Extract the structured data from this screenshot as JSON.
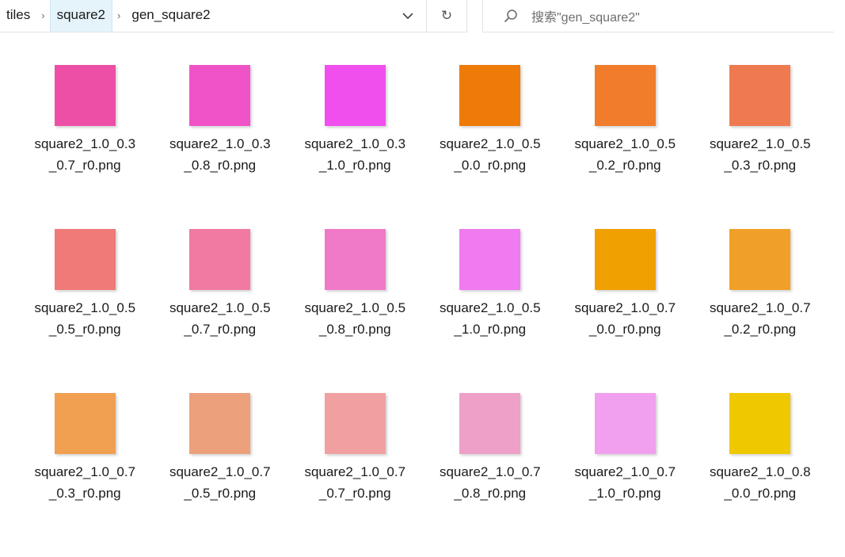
{
  "breadcrumb": {
    "items": [
      "tiles",
      "square2",
      "gen_square2"
    ]
  },
  "refresh_glyph": "↻",
  "search": {
    "placeholder": "搜索\"gen_square2\""
  },
  "files": [
    {
      "line1": "square2_1.0_0.3",
      "line2": "_0.7_r0.png",
      "color": "#ee4fa6"
    },
    {
      "line1": "square2_1.0_0.3",
      "line2": "_0.8_r0.png",
      "color": "#f052c8"
    },
    {
      "line1": "square2_1.0_0.3",
      "line2": "_1.0_r0.png",
      "color": "#f04fee"
    },
    {
      "line1": "square2_1.0_0.5",
      "line2": "_0.0_r0.png",
      "color": "#ee7a08"
    },
    {
      "line1": "square2_1.0_0.5",
      "line2": "_0.2_r0.png",
      "color": "#f07c2c"
    },
    {
      "line1": "square2_1.0_0.5",
      "line2": "_0.3_r0.png",
      "color": "#f07a50"
    },
    {
      "line1": "square2_1.0_0.5",
      "line2": "_0.5_r0.png",
      "color": "#f07a78"
    },
    {
      "line1": "square2_1.0_0.5",
      "line2": "_0.7_r0.png",
      "color": "#f07aa2"
    },
    {
      "line1": "square2_1.0_0.5",
      "line2": "_0.8_r0.png",
      "color": "#f07ac8"
    },
    {
      "line1": "square2_1.0_0.5",
      "line2": "_1.0_r0.png",
      "color": "#f07af0"
    },
    {
      "line1": "square2_1.0_0.7",
      "line2": "_0.0_r0.png",
      "color": "#f0a000"
    },
    {
      "line1": "square2_1.0_0.7",
      "line2": "_0.2_r0.png",
      "color": "#f0a028"
    },
    {
      "line1": "square2_1.0_0.7",
      "line2": "_0.3_r0.png",
      "color": "#f0a050"
    },
    {
      "line1": "square2_1.0_0.7",
      "line2": "_0.5_r0.png",
      "color": "#eca07c"
    },
    {
      "line1": "square2_1.0_0.7",
      "line2": "_0.7_r0.png",
      "color": "#f0a0a0"
    },
    {
      "line1": "square2_1.0_0.7",
      "line2": "_0.8_r0.png",
      "color": "#eea0c8"
    },
    {
      "line1": "square2_1.0_0.7",
      "line2": "_1.0_r0.png",
      "color": "#f0a0ee"
    },
    {
      "line1": "square2_1.0_0.8",
      "line2": "_0.0_r0.png",
      "color": "#f0c800"
    }
  ]
}
